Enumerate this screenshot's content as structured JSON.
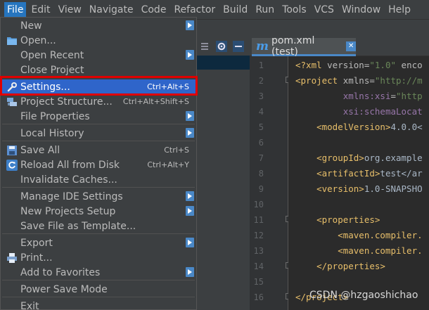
{
  "menubar": {
    "items": [
      "File",
      "Edit",
      "View",
      "Navigate",
      "Code",
      "Refactor",
      "Build",
      "Run",
      "Tools",
      "VCS",
      "Window",
      "Help"
    ],
    "active_index": 0
  },
  "file_menu": {
    "items": [
      {
        "label": "New",
        "shortcut": "",
        "submenu": true,
        "icon": ""
      },
      {
        "label": "Open...",
        "shortcut": "",
        "submenu": false,
        "icon": "folder-icon"
      },
      {
        "label": "Open Recent",
        "shortcut": "",
        "submenu": true,
        "icon": ""
      },
      {
        "label": "Close Project",
        "shortcut": "",
        "submenu": false,
        "icon": ""
      },
      {
        "label": "Settings...",
        "shortcut": "Ctrl+Alt+S",
        "submenu": false,
        "icon": "wrench-icon"
      },
      {
        "label": "Project Structure...",
        "shortcut": "Ctrl+Alt+Shift+S",
        "submenu": false,
        "icon": "project-structure-icon"
      },
      {
        "label": "File Properties",
        "shortcut": "",
        "submenu": true,
        "icon": ""
      },
      {
        "label": "Local History",
        "shortcut": "",
        "submenu": true,
        "icon": ""
      },
      {
        "label": "Save All",
        "shortcut": "Ctrl+S",
        "submenu": false,
        "icon": "save-icon"
      },
      {
        "label": "Reload All from Disk",
        "shortcut": "Ctrl+Alt+Y",
        "submenu": false,
        "icon": "reload-icon"
      },
      {
        "label": "Invalidate Caches...",
        "shortcut": "",
        "submenu": false,
        "icon": ""
      },
      {
        "label": "Manage IDE Settings",
        "shortcut": "",
        "submenu": true,
        "icon": ""
      },
      {
        "label": "New Projects Setup",
        "shortcut": "",
        "submenu": true,
        "icon": ""
      },
      {
        "label": "Save File as Template...",
        "shortcut": "",
        "submenu": false,
        "icon": ""
      },
      {
        "label": "Export",
        "shortcut": "",
        "submenu": true,
        "icon": ""
      },
      {
        "label": "Print...",
        "shortcut": "",
        "submenu": false,
        "icon": "print-icon"
      },
      {
        "label": "Add to Favorites",
        "shortcut": "",
        "submenu": true,
        "icon": ""
      },
      {
        "label": "Power Save Mode",
        "shortcut": "",
        "submenu": false,
        "icon": ""
      },
      {
        "label": "Exit",
        "shortcut": "",
        "submenu": false,
        "icon": ""
      }
    ],
    "selected_index": 4
  },
  "editor": {
    "tab_label": "pom.xml (test)",
    "tab_icon": "maven-icon",
    "line_numbers": [
      "1",
      "2",
      "3",
      "4",
      "5",
      "6",
      "7",
      "8",
      "9",
      "10",
      "11",
      "12",
      "13",
      "14",
      "15",
      "16"
    ],
    "lines": [
      {
        "n": 1,
        "pre": "<?xml ",
        "a1": "version",
        "eq1": "=",
        "s1": "\"1.0\"",
        "rest": " enco"
      },
      {
        "n": 2,
        "pre": "<project ",
        "a1": "xmlns",
        "eq1": "=",
        "s1": "\"http://m",
        "rest": ""
      },
      {
        "n": 3,
        "pre": "         ",
        "a1": "xmlns:xsi",
        "eq1": "=",
        "s1": "\"http",
        "rest": ""
      },
      {
        "n": 4,
        "pre": "         ",
        "a1": "xsi:schemaLocat",
        "eq1": "",
        "s1": "",
        "rest": ""
      },
      {
        "n": 5,
        "pre": "    <modelVersion>",
        "a1": "",
        "eq1": "",
        "s1": "",
        "rest": "4.0.0<"
      },
      {
        "n": 7,
        "pre": "    <groupId>",
        "a1": "",
        "eq1": "",
        "s1": "",
        "rest": "org.example"
      },
      {
        "n": 8,
        "pre": "    <artifactId>",
        "a1": "",
        "eq1": "",
        "s1": "",
        "rest": "test</ar"
      },
      {
        "n": 9,
        "pre": "    <version>",
        "a1": "",
        "eq1": "",
        "s1": "",
        "rest": "1.0-SNAPSHO"
      },
      {
        "n": 11,
        "pre": "    <properties>",
        "a1": "",
        "eq1": "",
        "s1": "",
        "rest": ""
      },
      {
        "n": 12,
        "pre": "        <maven.compiler.",
        "a1": "",
        "eq1": "",
        "s1": "",
        "rest": ""
      },
      {
        "n": 13,
        "pre": "        <maven.compiler.",
        "a1": "",
        "eq1": "",
        "s1": "",
        "rest": ""
      },
      {
        "n": 14,
        "pre": "    </properties>",
        "a1": "",
        "eq1": "",
        "s1": "",
        "rest": ""
      },
      {
        "n": 16,
        "pre": "</project>",
        "a1": "",
        "eq1": "",
        "s1": "",
        "rest": ""
      }
    ]
  },
  "watermark": "CSDN @hzgaoshichao",
  "colors": {
    "menu_bg": "#3c3f41",
    "editor_bg": "#2b2b2b",
    "selection": "#2f65ca",
    "highlight_border": "#e00000",
    "tag": "#e8bf6a",
    "string": "#6a8759"
  }
}
